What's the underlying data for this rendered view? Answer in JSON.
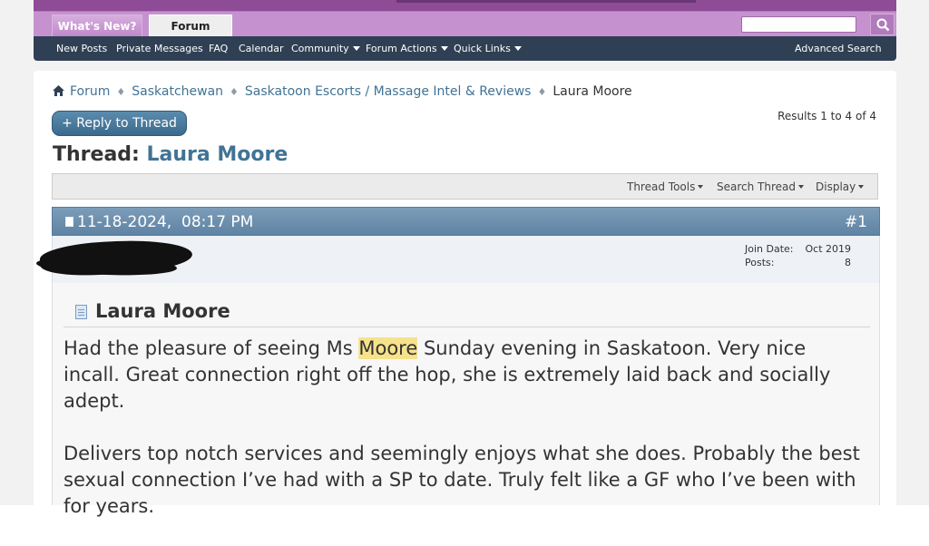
{
  "tabs": {
    "whats_new": "What's New?",
    "forum": "Forum"
  },
  "search": {
    "placeholder": ""
  },
  "nav": {
    "new_posts": "New Posts",
    "private_messages": "Private Messages",
    "faq": "FAQ",
    "calendar": "Calendar",
    "community": "Community",
    "forum_actions": "Forum Actions",
    "quick_links": "Quick Links",
    "advanced_search": "Advanced Search"
  },
  "breadcrumb": [
    "Forum",
    "Saskatchewan",
    "Saskatoon Escorts / Massage Intel & Reviews",
    "Laura Moore"
  ],
  "reply_button": "+ Reply to Thread",
  "results": "Results 1 to 4 of 4",
  "thread": {
    "prefix": "Thread:",
    "name": "Laura Moore"
  },
  "tools": {
    "thread_tools": "Thread Tools",
    "search_thread": "Search Thread",
    "display": "Display"
  },
  "post": {
    "date": "11-18-2024,",
    "time": "08:17 PM",
    "number": "#1",
    "join_date_label": "Join Date:",
    "join_date": "Oct 2019",
    "posts_label": "Posts:",
    "posts": "8",
    "title": "Laura Moore",
    "p1_before": "Had the pleasure of seeing Ms ",
    "p1_highlight": "Moore",
    "p1_after": " Sunday evening in Saskatoon. Very nice incall. Great connection right off the hop, she is extremely laid back and socially adept.",
    "p2": "Delivers top notch services and seemingly enjoys what she does. Probably the best sexual connection I’ve had with a SP to date. Truly felt like a GF who I’ve been with for years."
  },
  "colors": {
    "banner": "#8e4b96",
    "tabbar": "#c592cf",
    "navbar": "#2f4054",
    "link": "#417394",
    "post_header": "#6a8dad",
    "highlight": "#f7e28c"
  },
  "icons": [
    "home-icon",
    "breadcrumb-separator-icon",
    "search-icon",
    "post-icon",
    "document-icon",
    "caret-down-icon"
  ]
}
